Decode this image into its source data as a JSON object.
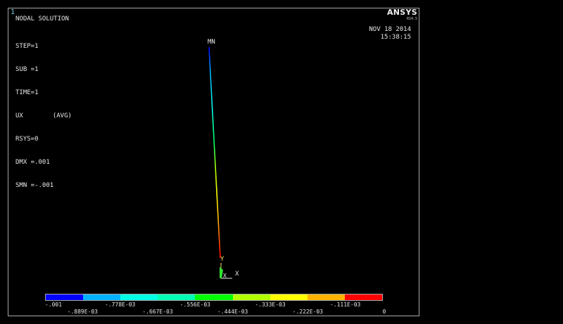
{
  "window": {
    "number": "1",
    "title": "NODAL SOLUTION"
  },
  "info": {
    "step": "STEP=1",
    "sub": "SUB =1",
    "time": "TIME=1",
    "result": "UX",
    "avg": "(AVG)",
    "rsys": "RSYS=0",
    "dmx": "DMX =.001",
    "smn": "SMN =-.001"
  },
  "logo": {
    "name": "ANSYS",
    "version": "R14.5"
  },
  "timestamp": {
    "date": "NOV 18 2014",
    "time": "15:38:15"
  },
  "model": {
    "min_label": "MN",
    "axis_y": "Y",
    "axis_x": "X",
    "axis_x_small": "X"
  },
  "legend": {
    "colors": [
      "#0000ff",
      "#00b2ff",
      "#00ffe5",
      "#00ffb2",
      "#00ff00",
      "#b2ff00",
      "#ffff00",
      "#ffb200",
      "#ff0000"
    ],
    "labels_top_row": [
      "-.001",
      "-.778E-03",
      "-.556E-03",
      "-.333E-03",
      "-.111E-03"
    ],
    "labels_bottom_row": [
      "-.889E-03",
      "-.667E-03",
      "-.444E-03",
      "-.222E-03",
      "0"
    ]
  }
}
